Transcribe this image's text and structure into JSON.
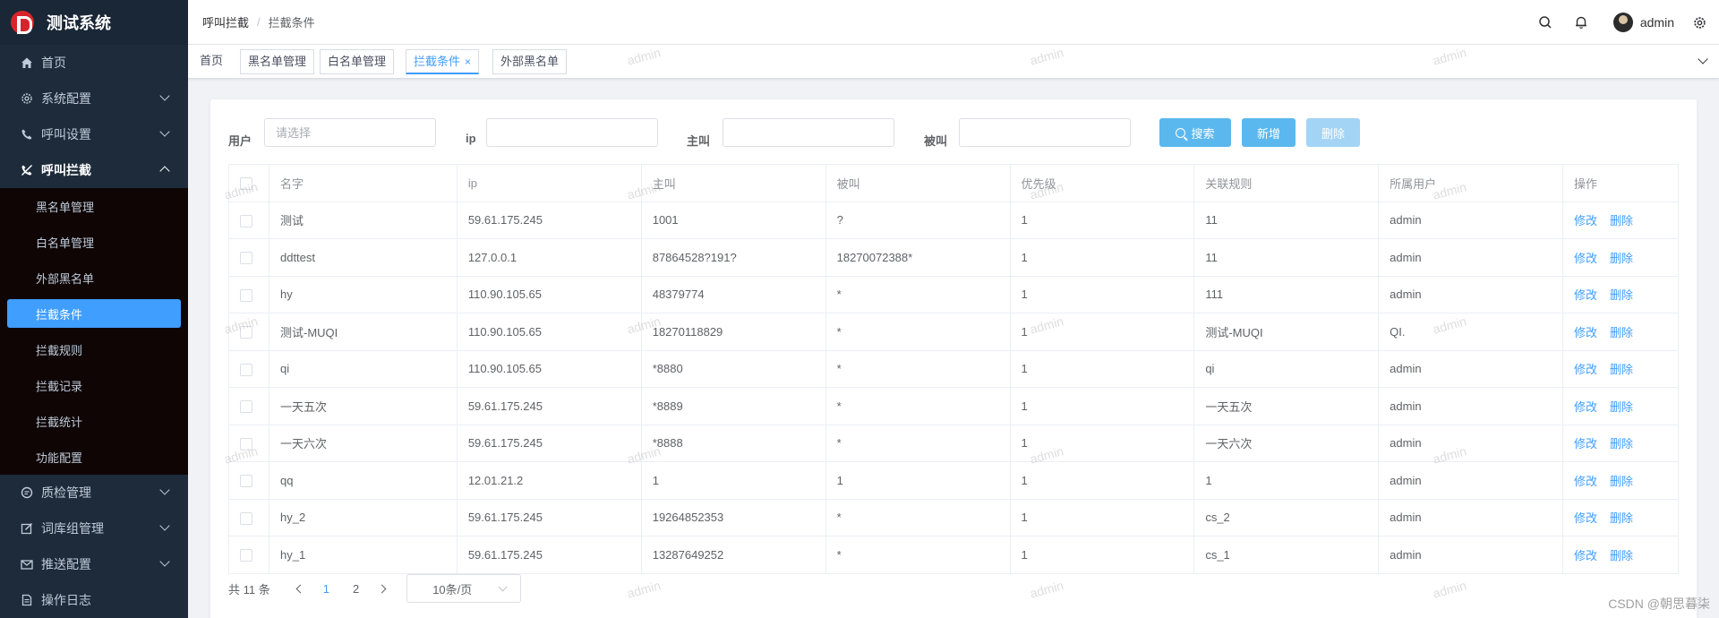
{
  "app": {
    "title": "测试系统"
  },
  "sidebar": {
    "items": [
      {
        "label": "首页",
        "icon": "home-icon"
      },
      {
        "label": "系统配置",
        "icon": "gear-icon"
      },
      {
        "label": "呼叫设置",
        "icon": "phone-icon"
      },
      {
        "label": "呼叫拦截",
        "icon": "phone-block-icon"
      },
      {
        "label": "质检管理",
        "icon": "chat-icon"
      },
      {
        "label": "词库组管理",
        "icon": "edit-icon"
      },
      {
        "label": "推送配置",
        "icon": "mail-icon"
      },
      {
        "label": "操作日志",
        "icon": "document-icon"
      }
    ],
    "submenu": [
      "黑名单管理",
      "白名单管理",
      "外部黑名单",
      "拦截条件",
      "拦截规则",
      "拦截记录",
      "拦截统计",
      "功能配置"
    ]
  },
  "header": {
    "breadcrumb": [
      "呼叫拦截",
      "拦截条件"
    ],
    "separator": "/",
    "username": "admin"
  },
  "tags": [
    {
      "label": "首页"
    },
    {
      "label": "黑名单管理"
    },
    {
      "label": "白名单管理"
    },
    {
      "label": "拦截条件",
      "close": "×"
    },
    {
      "label": "外部黑名单"
    }
  ],
  "filters": {
    "user_label": "用户",
    "user_placeholder": "请选择",
    "ip_label": "ip",
    "caller_label": "主叫",
    "callee_label": "被叫"
  },
  "buttons": {
    "search": "搜索",
    "add": "新增",
    "delete": "删除"
  },
  "table": {
    "headers": [
      "名字",
      "ip",
      "主叫",
      "被叫",
      "优先级",
      "关联规则",
      "所属用户",
      "操作"
    ],
    "edit_label": "修改",
    "delete_label": "删除",
    "rows": [
      [
        "测试",
        "59.61.175.245",
        "1001",
        "?",
        "1",
        "11",
        "admin"
      ],
      [
        "ddttest",
        "127.0.0.1",
        "87864528?191?",
        "18270072388*",
        "1",
        "11",
        "admin"
      ],
      [
        "hy",
        "110.90.105.65",
        "48379774",
        "*",
        "1",
        "111",
        "admin"
      ],
      [
        "测试-MUQI",
        "110.90.105.65",
        "18270118829",
        "*",
        "1",
        "测试-MUQI",
        "QI."
      ],
      [
        "qi",
        "110.90.105.65",
        "*8880",
        "*",
        "1",
        "qi",
        "admin"
      ],
      [
        "一天五次",
        "59.61.175.245",
        "*8889",
        "*",
        "1",
        "一天五次",
        "admin"
      ],
      [
        "一天六次",
        "59.61.175.245",
        "*8888",
        "*",
        "1",
        "一天六次",
        "admin"
      ],
      [
        "qq",
        "12.01.21.2",
        "1",
        "1",
        "1",
        "1",
        "admin"
      ],
      [
        "hy_2",
        "59.61.175.245",
        "19264852353",
        "*",
        "1",
        "cs_2",
        "admin"
      ],
      [
        "hy_1",
        "59.61.175.245",
        "13287649252",
        "*",
        "1",
        "cs_1",
        "admin"
      ]
    ]
  },
  "pagination": {
    "total": "共 11 条",
    "pages": [
      "1",
      "2"
    ],
    "page_size": "10条/页"
  },
  "watermark": "admin",
  "footer_credit": "CSDN @朝思暮柒",
  "colors": {
    "accent": "#409eff",
    "sidebar_bg": "#1d2b3a",
    "submenu_bg": "#0f0505"
  }
}
